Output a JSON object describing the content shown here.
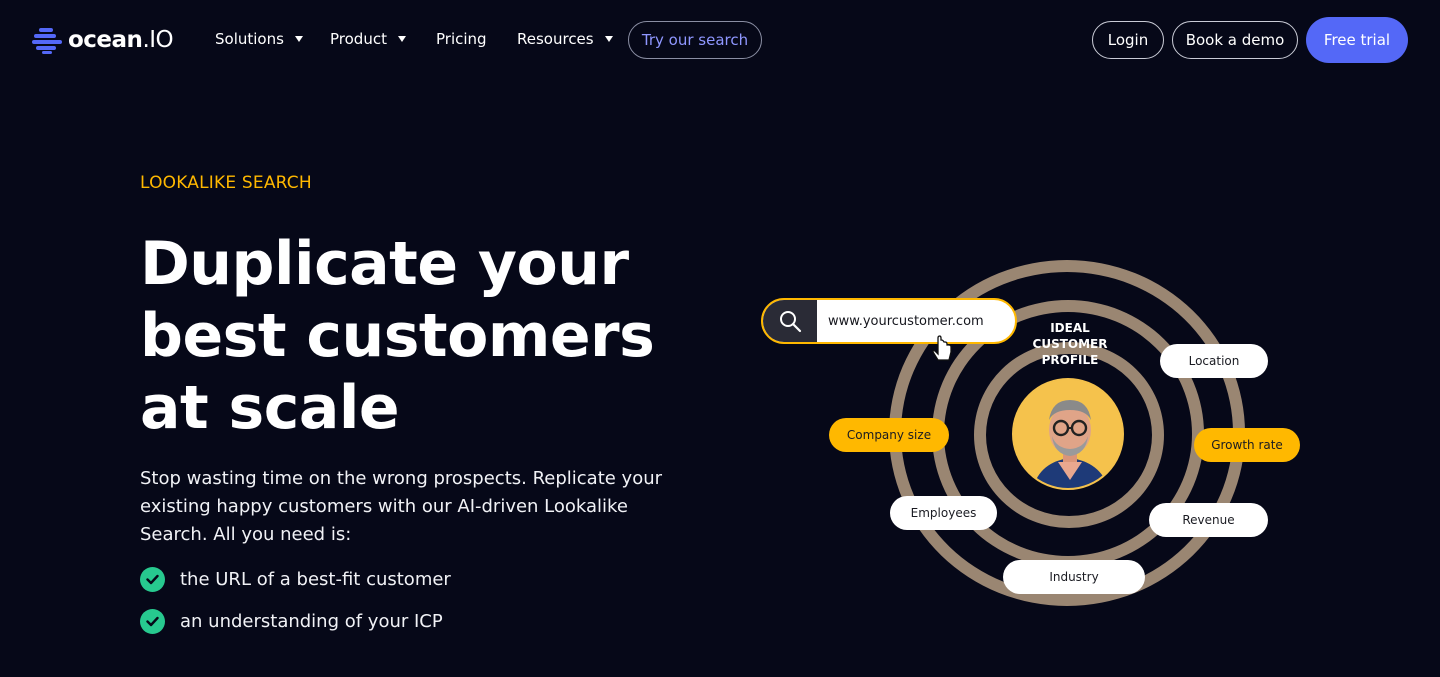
{
  "brand": {
    "name": "ocean",
    "suffix": ".IO",
    "logo_icon": "ocean-logo-icon",
    "accent": "#5468f7",
    "eyebrow_color": "#ffb800",
    "check_color": "#27c98f"
  },
  "nav": {
    "items": [
      {
        "label": "Solutions",
        "dropdown": true
      },
      {
        "label": "Product",
        "dropdown": true
      },
      {
        "label": "Pricing",
        "dropdown": false
      },
      {
        "label": "Resources",
        "dropdown": true
      }
    ],
    "try_search": "Try our search",
    "login": "Login",
    "book_demo": "Book a demo",
    "free_trial": "Free trial"
  },
  "hero": {
    "eyebrow": "LOOKALIKE SEARCH",
    "headline": [
      "Duplicate your",
      "best customers",
      "at scale"
    ],
    "lead": "Stop wasting time on the wrong prospects. Replicate your existing happy customers with our AI-driven Lookalike Search. All you need is:",
    "checklist": [
      "the URL of a best-fit customer",
      "an understanding of your ICP"
    ]
  },
  "illustration": {
    "search_value": "www.yourcustomer.com",
    "icp_label": [
      "IDEAL",
      "CUSTOMER",
      "PROFILE"
    ],
    "tags": {
      "location": "Location",
      "company_size": "Company size",
      "growth_rate": "Growth rate",
      "employees": "Employees",
      "revenue": "Revenue",
      "industry": "Industry"
    }
  }
}
